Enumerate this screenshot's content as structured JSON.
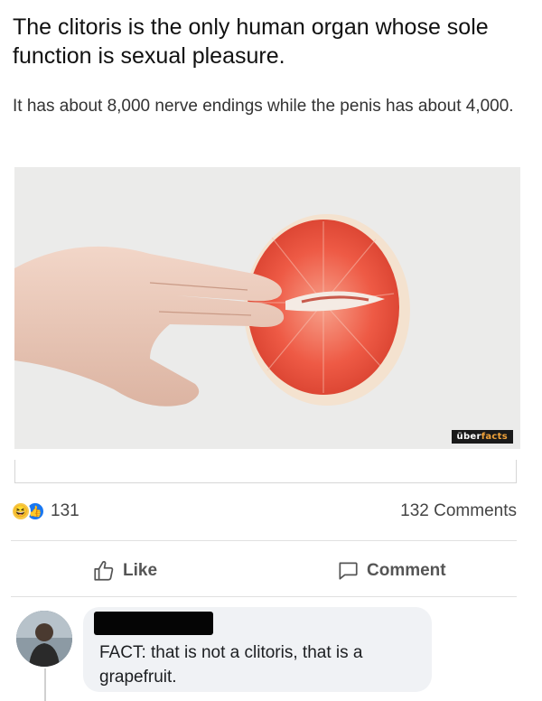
{
  "post": {
    "title": "The clitoris is the only human organ whose sole function is sexual pleasure.",
    "subtitle": "It has about 8,000 nerve endings while the penis has about 4,000."
  },
  "media": {
    "watermark_prefix": "über",
    "watermark_suffix": "facts",
    "accent_color": "#f0a23a"
  },
  "engagement": {
    "reactions": [
      "haha-icon",
      "like-icon"
    ],
    "reaction_count": "131",
    "comments_label": "132 Comments"
  },
  "actions": {
    "like_label": "Like",
    "comment_label": "Comment"
  },
  "comment": {
    "author_redacted": true,
    "text": "FACT: that is not a clitoris, that is a grapefruit."
  }
}
